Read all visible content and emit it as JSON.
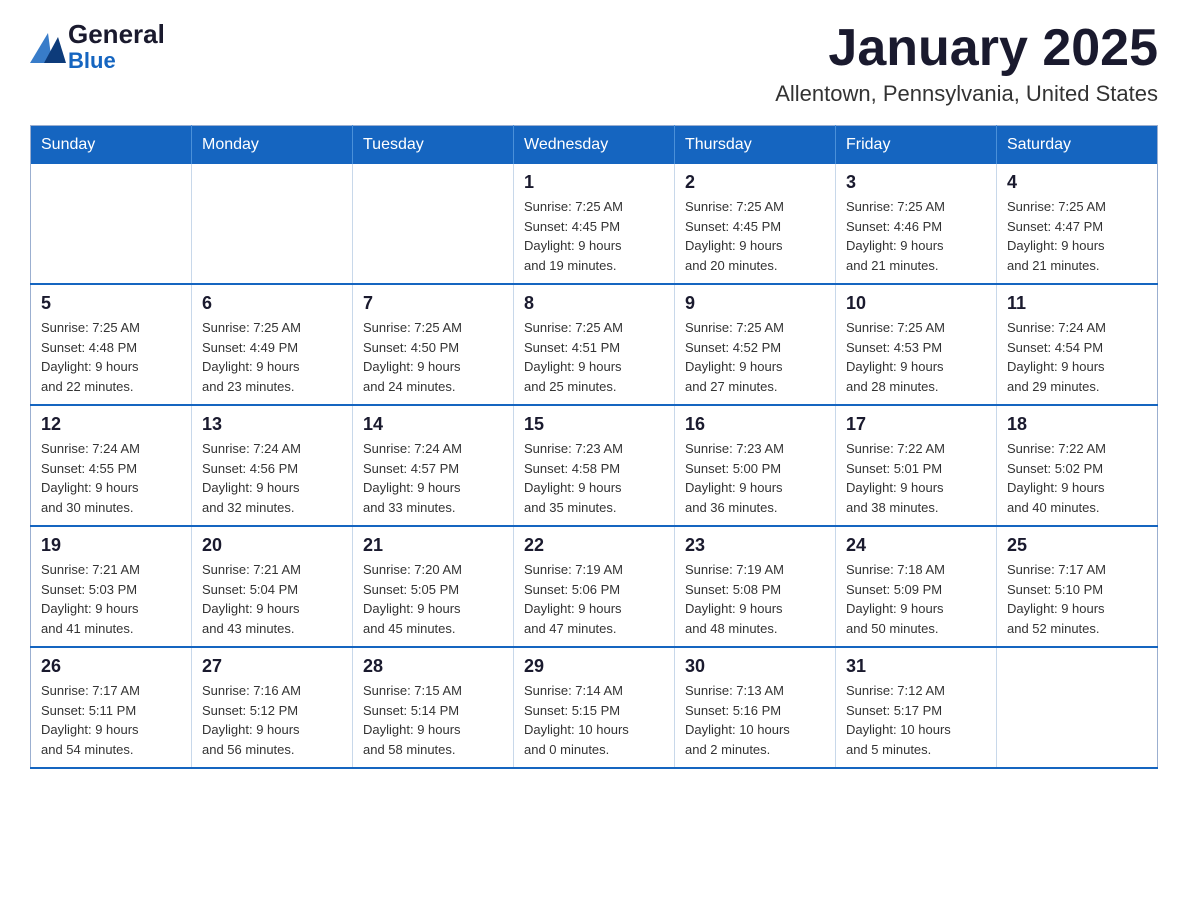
{
  "header": {
    "logo_general": "General",
    "logo_blue": "Blue",
    "month_title": "January 2025",
    "location": "Allentown, Pennsylvania, United States"
  },
  "days_of_week": [
    "Sunday",
    "Monday",
    "Tuesday",
    "Wednesday",
    "Thursday",
    "Friday",
    "Saturday"
  ],
  "weeks": [
    [
      {
        "day": "",
        "info": ""
      },
      {
        "day": "",
        "info": ""
      },
      {
        "day": "",
        "info": ""
      },
      {
        "day": "1",
        "info": "Sunrise: 7:25 AM\nSunset: 4:45 PM\nDaylight: 9 hours\nand 19 minutes."
      },
      {
        "day": "2",
        "info": "Sunrise: 7:25 AM\nSunset: 4:45 PM\nDaylight: 9 hours\nand 20 minutes."
      },
      {
        "day": "3",
        "info": "Sunrise: 7:25 AM\nSunset: 4:46 PM\nDaylight: 9 hours\nand 21 minutes."
      },
      {
        "day": "4",
        "info": "Sunrise: 7:25 AM\nSunset: 4:47 PM\nDaylight: 9 hours\nand 21 minutes."
      }
    ],
    [
      {
        "day": "5",
        "info": "Sunrise: 7:25 AM\nSunset: 4:48 PM\nDaylight: 9 hours\nand 22 minutes."
      },
      {
        "day": "6",
        "info": "Sunrise: 7:25 AM\nSunset: 4:49 PM\nDaylight: 9 hours\nand 23 minutes."
      },
      {
        "day": "7",
        "info": "Sunrise: 7:25 AM\nSunset: 4:50 PM\nDaylight: 9 hours\nand 24 minutes."
      },
      {
        "day": "8",
        "info": "Sunrise: 7:25 AM\nSunset: 4:51 PM\nDaylight: 9 hours\nand 25 minutes."
      },
      {
        "day": "9",
        "info": "Sunrise: 7:25 AM\nSunset: 4:52 PM\nDaylight: 9 hours\nand 27 minutes."
      },
      {
        "day": "10",
        "info": "Sunrise: 7:25 AM\nSunset: 4:53 PM\nDaylight: 9 hours\nand 28 minutes."
      },
      {
        "day": "11",
        "info": "Sunrise: 7:24 AM\nSunset: 4:54 PM\nDaylight: 9 hours\nand 29 minutes."
      }
    ],
    [
      {
        "day": "12",
        "info": "Sunrise: 7:24 AM\nSunset: 4:55 PM\nDaylight: 9 hours\nand 30 minutes."
      },
      {
        "day": "13",
        "info": "Sunrise: 7:24 AM\nSunset: 4:56 PM\nDaylight: 9 hours\nand 32 minutes."
      },
      {
        "day": "14",
        "info": "Sunrise: 7:24 AM\nSunset: 4:57 PM\nDaylight: 9 hours\nand 33 minutes."
      },
      {
        "day": "15",
        "info": "Sunrise: 7:23 AM\nSunset: 4:58 PM\nDaylight: 9 hours\nand 35 minutes."
      },
      {
        "day": "16",
        "info": "Sunrise: 7:23 AM\nSunset: 5:00 PM\nDaylight: 9 hours\nand 36 minutes."
      },
      {
        "day": "17",
        "info": "Sunrise: 7:22 AM\nSunset: 5:01 PM\nDaylight: 9 hours\nand 38 minutes."
      },
      {
        "day": "18",
        "info": "Sunrise: 7:22 AM\nSunset: 5:02 PM\nDaylight: 9 hours\nand 40 minutes."
      }
    ],
    [
      {
        "day": "19",
        "info": "Sunrise: 7:21 AM\nSunset: 5:03 PM\nDaylight: 9 hours\nand 41 minutes."
      },
      {
        "day": "20",
        "info": "Sunrise: 7:21 AM\nSunset: 5:04 PM\nDaylight: 9 hours\nand 43 minutes."
      },
      {
        "day": "21",
        "info": "Sunrise: 7:20 AM\nSunset: 5:05 PM\nDaylight: 9 hours\nand 45 minutes."
      },
      {
        "day": "22",
        "info": "Sunrise: 7:19 AM\nSunset: 5:06 PM\nDaylight: 9 hours\nand 47 minutes."
      },
      {
        "day": "23",
        "info": "Sunrise: 7:19 AM\nSunset: 5:08 PM\nDaylight: 9 hours\nand 48 minutes."
      },
      {
        "day": "24",
        "info": "Sunrise: 7:18 AM\nSunset: 5:09 PM\nDaylight: 9 hours\nand 50 minutes."
      },
      {
        "day": "25",
        "info": "Sunrise: 7:17 AM\nSunset: 5:10 PM\nDaylight: 9 hours\nand 52 minutes."
      }
    ],
    [
      {
        "day": "26",
        "info": "Sunrise: 7:17 AM\nSunset: 5:11 PM\nDaylight: 9 hours\nand 54 minutes."
      },
      {
        "day": "27",
        "info": "Sunrise: 7:16 AM\nSunset: 5:12 PM\nDaylight: 9 hours\nand 56 minutes."
      },
      {
        "day": "28",
        "info": "Sunrise: 7:15 AM\nSunset: 5:14 PM\nDaylight: 9 hours\nand 58 minutes."
      },
      {
        "day": "29",
        "info": "Sunrise: 7:14 AM\nSunset: 5:15 PM\nDaylight: 10 hours\nand 0 minutes."
      },
      {
        "day": "30",
        "info": "Sunrise: 7:13 AM\nSunset: 5:16 PM\nDaylight: 10 hours\nand 2 minutes."
      },
      {
        "day": "31",
        "info": "Sunrise: 7:12 AM\nSunset: 5:17 PM\nDaylight: 10 hours\nand 5 minutes."
      },
      {
        "day": "",
        "info": ""
      }
    ]
  ]
}
